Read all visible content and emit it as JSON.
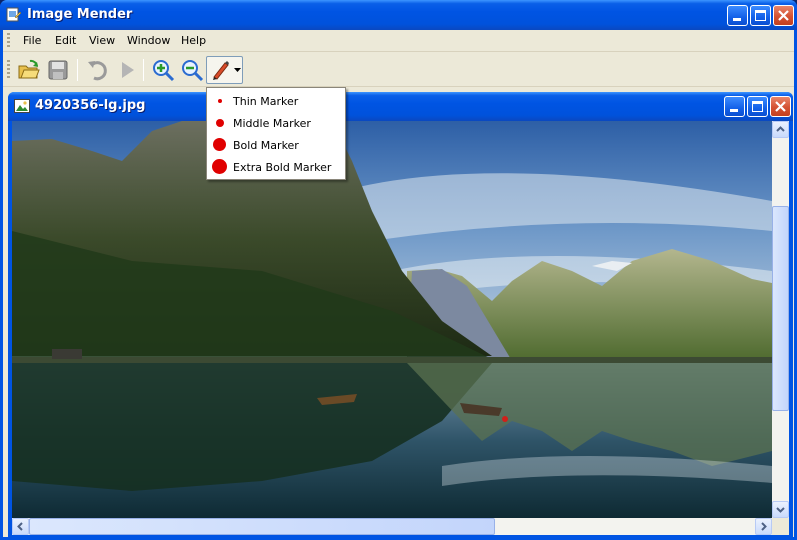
{
  "window": {
    "title": "Image Mender"
  },
  "menu": {
    "items": [
      "File",
      "Edit",
      "View",
      "Window",
      "Help"
    ]
  },
  "toolbar": {
    "buttons": [
      "open-folder-icon",
      "save-icon",
      "undo-icon",
      "play-icon",
      "zoom-in-icon",
      "zoom-out-icon",
      "marker-pen-icon"
    ]
  },
  "document": {
    "title": "4920356-lg.jpg"
  },
  "marker_menu": {
    "items": [
      {
        "label": "Thin Marker"
      },
      {
        "label": "Middle Marker"
      },
      {
        "label": "Bold Marker"
      },
      {
        "label": "Extra Bold Marker"
      }
    ]
  },
  "colors": {
    "titlebar": "#0054e3",
    "marker_red": "#e00000",
    "chrome": "#ece9d8"
  }
}
